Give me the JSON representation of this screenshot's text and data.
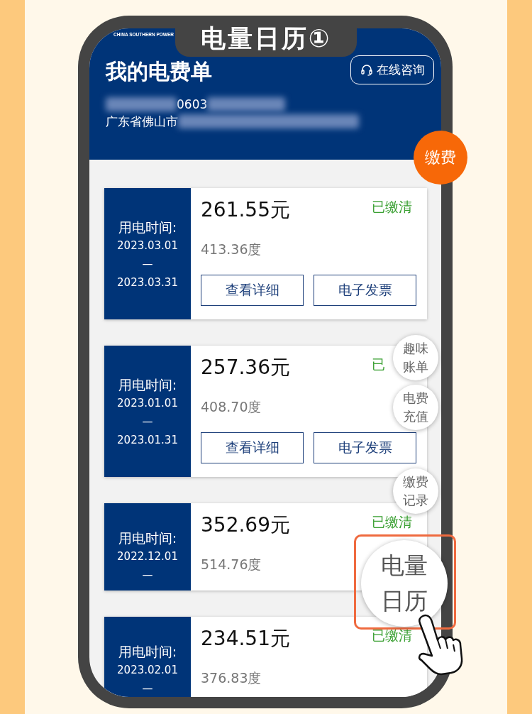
{
  "badge": "电量日历①",
  "brand": "CHINA SOUTHERN POWER",
  "header": {
    "title": "我的电费单",
    "consult_button": "在线咨询",
    "account_visible": "0603",
    "address_visible": "广东省佛山市"
  },
  "pay_button": "缴费",
  "bills": [
    {
      "period_label": "用电时间:",
      "start": "2023.03.01",
      "dash": "—",
      "end": "2023.03.31",
      "amount": "261.55元",
      "usage": "413.36度",
      "status": "已缴清",
      "buttons": [
        "查看详细",
        "电子发票"
      ]
    },
    {
      "period_label": "用电时间:",
      "start": "2023.01.01",
      "dash": "—",
      "end": "2023.01.31",
      "amount": "257.36元",
      "usage": "408.70度",
      "status": "已",
      "buttons": [
        "查看详细",
        "电子发票"
      ]
    },
    {
      "period_label": "用电时间:",
      "start": "2022.12.01",
      "dash": "—",
      "amount": "352.69元",
      "usage": "514.76度",
      "status": "已缴清"
    },
    {
      "period_label": "用电时间:",
      "start": "2023.02.01",
      "dash": "—",
      "amount": "234.51元",
      "usage": "376.83度",
      "status": "已缴清"
    }
  ],
  "float_buttons": [
    {
      "line1": "趣味",
      "line2": "账单",
      "highlighted": false
    },
    {
      "line1": "电费",
      "line2": "充值",
      "highlighted": false
    },
    {
      "line1": "缴费",
      "line2": "记录",
      "highlighted": false
    },
    {
      "line1": "电量",
      "line2": "日历",
      "highlighted": true
    }
  ]
}
